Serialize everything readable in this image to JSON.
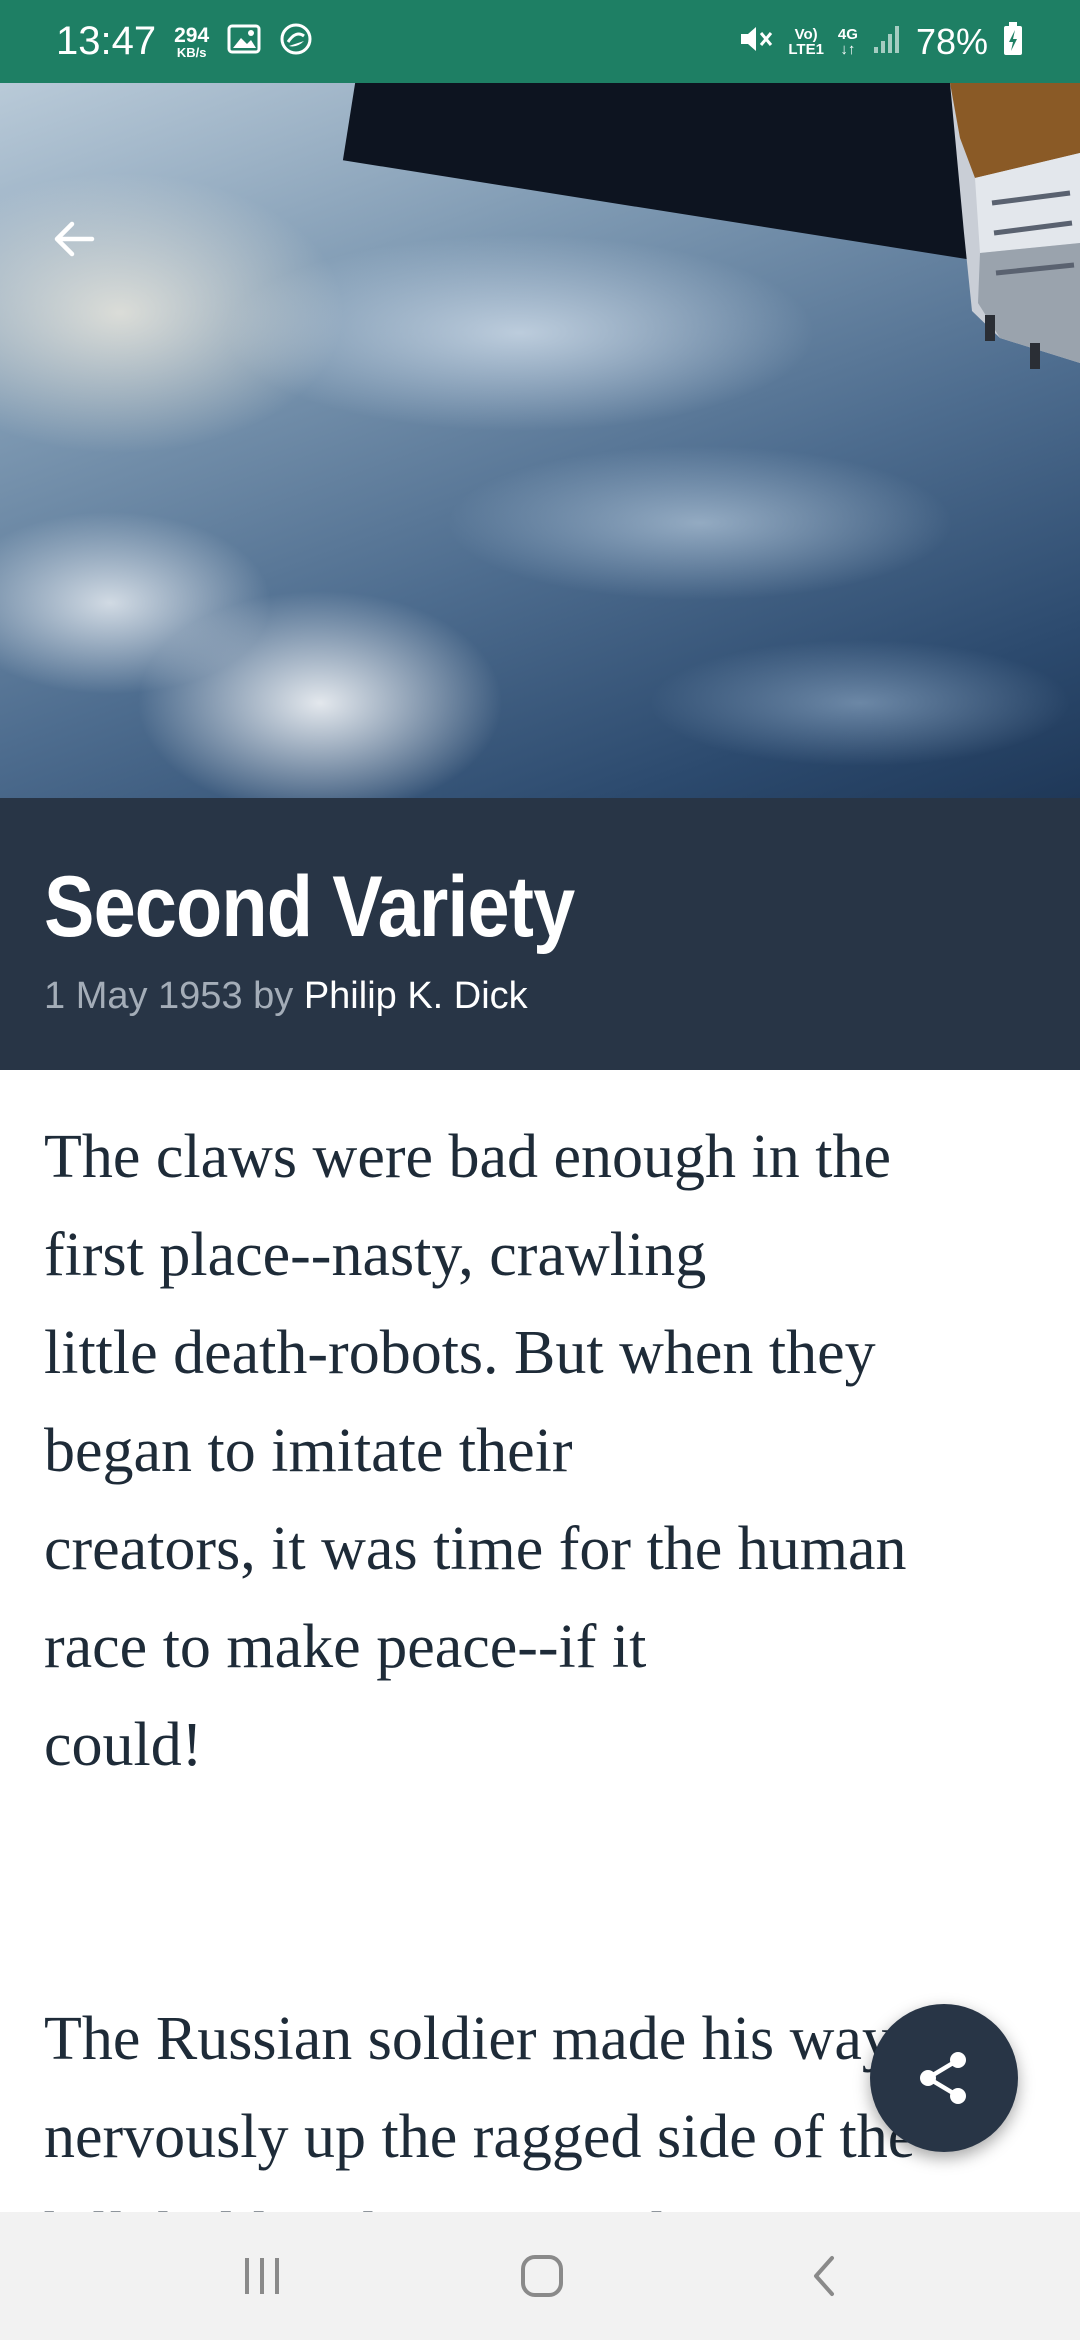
{
  "status_bar": {
    "time": "13:47",
    "data_speed_value": "294",
    "data_speed_unit": "KB/s",
    "volte_label": "Vo)",
    "lte_label": "LTE1",
    "network_type": "4G",
    "battery_percent": "78%",
    "icons": [
      "gallery-icon",
      "sync-icon",
      "mute-icon",
      "signal-icon",
      "battery-charging-icon"
    ]
  },
  "header": {
    "back_icon": "arrow-left-icon"
  },
  "story": {
    "title": "Second Variety",
    "date_prefix": "1 May 1953 by",
    "author": "Philip K. Dick",
    "paragraphs": [
      "The claws were bad enough in the first place--nasty, crawling little death-robots. But when they began to imitate their creators, it was time for the human race to make peace--if it could!",
      "The Russian soldier made his way nervously up the ragged side of the hill, holding his gun ready. He"
    ],
    "paragraph_lines": [
      [
        "The claws were bad enough in the",
        "first place--nasty, crawling",
        "little death-robots. But when they",
        "began to imitate their",
        "creators, it was time for the human",
        "race to make peace--if it",
        "could!"
      ],
      [
        "The Russian soldier made his way",
        "nervously up the ragged side of the",
        "hill, holding his gun ready. He"
      ]
    ]
  },
  "fab": {
    "icon": "share-icon"
  },
  "nav_bar": {
    "icons": [
      "recent-apps-icon",
      "home-icon",
      "back-icon"
    ]
  },
  "colors": {
    "status_bar": "#1e7f64",
    "title_band": "#283546",
    "body_text": "#1e2b38",
    "nav_bar": "#f2f2f2"
  }
}
